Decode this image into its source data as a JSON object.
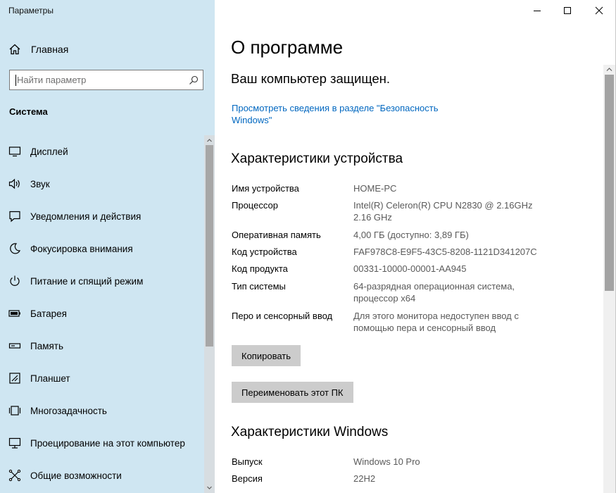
{
  "window": {
    "title": "Параметры"
  },
  "sidebar": {
    "home": "Главная",
    "search_placeholder": "Найти параметр",
    "section": "Система",
    "items": [
      {
        "label": "Дисплей",
        "icon": "display-icon"
      },
      {
        "label": "Звук",
        "icon": "speaker-icon"
      },
      {
        "label": "Уведомления и действия",
        "icon": "notification-icon"
      },
      {
        "label": "Фокусировка внимания",
        "icon": "moon-icon"
      },
      {
        "label": "Питание и спящий режим",
        "icon": "power-icon"
      },
      {
        "label": "Батарея",
        "icon": "battery-icon"
      },
      {
        "label": "Память",
        "icon": "storage-icon"
      },
      {
        "label": "Планшет",
        "icon": "tablet-icon"
      },
      {
        "label": "Многозадачность",
        "icon": "multitasking-icon"
      },
      {
        "label": "Проецирование на этот компьютер",
        "icon": "projecting-icon"
      },
      {
        "label": "Общие возможности",
        "icon": "shared-experiences-icon"
      }
    ]
  },
  "main": {
    "title": "О программе",
    "protection_status": "Ваш компьютер защищен.",
    "security_link": "Просмотреть сведения в разделе \"Безопасность Windows\"",
    "device_specs": {
      "heading": "Характеристики устройства",
      "rows": [
        {
          "key": "Имя устройства",
          "value": "HOME-PC"
        },
        {
          "key": "Процессор",
          "value": "Intel(R) Celeron(R) CPU  N2830  @ 2.16GHz 2.16 GHz"
        },
        {
          "key": "Оперативная память",
          "value": "4,00 ГБ (доступно: 3,89 ГБ)"
        },
        {
          "key": "Код устройства",
          "value": "FAF978C8-E9F5-43C5-8208-1121D341207C"
        },
        {
          "key": "Код продукта",
          "value": "00331-10000-00001-AA945"
        },
        {
          "key": "Тип системы",
          "value": "64-разрядная операционная система, процессор x64"
        },
        {
          "key": "Перо и сенсорный ввод",
          "value": "Для этого монитора недоступен ввод с помощью пера и сенсорный ввод"
        }
      ],
      "copy_button": "Копировать",
      "rename_button": "Переименовать этот ПК"
    },
    "windows_specs": {
      "heading": "Характеристики Windows",
      "rows": [
        {
          "key": "Выпуск",
          "value": "Windows 10 Pro"
        },
        {
          "key": "Версия",
          "value": "22H2"
        }
      ]
    }
  },
  "colors": {
    "sidebar_bg": "#cfe6f2",
    "link": "#0067c0",
    "button_bg": "#cccccc"
  }
}
